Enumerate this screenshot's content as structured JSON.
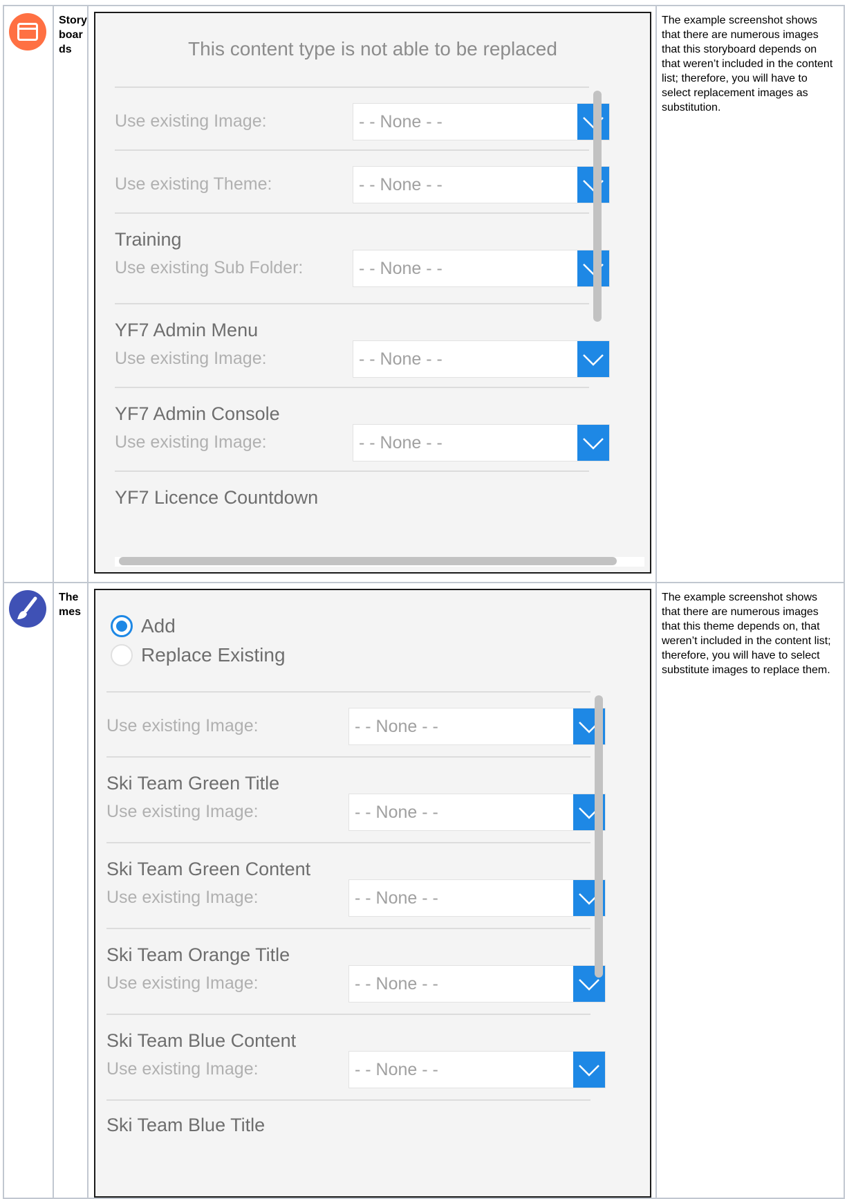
{
  "rows": [
    {
      "name": "Storyboards",
      "description": "The example screenshot shows that there are numerous images that this storyboard depends on that weren’t included in the content list; therefore, you will have to select replacement images as substitution.",
      "colors": {
        "icon": "#ff7043"
      },
      "panel": {
        "title": "This content type is not able to be replaced",
        "items": [
          {
            "title": "",
            "label": "Use existing Image:",
            "value": "- - None - -"
          },
          {
            "title": "",
            "label": "Use existing Theme:",
            "value": "- - None - -"
          },
          {
            "title": "Training",
            "label": "Use existing Sub Folder:",
            "value": "- - None - -"
          },
          {
            "title": "YF7 Admin Menu",
            "label": "Use existing Image:",
            "value": "- - None - -"
          },
          {
            "title": "YF7 Admin Console",
            "label": "Use existing Image:",
            "value": "- - None - -"
          },
          {
            "title": "YF7 Licence Countdown",
            "label": "",
            "value": ""
          }
        ]
      }
    },
    {
      "name": "Themes",
      "description": "The example screenshot shows that there are numerous images that this theme depends on, that weren’t included in the content list; therefore, you will have to select substitute images to replace them.",
      "colors": {
        "icon": "#3f51b5"
      },
      "panel": {
        "radio": [
          {
            "label": "Add",
            "selected": true
          },
          {
            "label": "Replace Existing",
            "selected": false
          }
        ],
        "items": [
          {
            "title": "",
            "label": "Use existing Image:",
            "value": "- - None - -"
          },
          {
            "title": "Ski Team Green Title",
            "label": "Use existing Image:",
            "value": "- - None - -"
          },
          {
            "title": "Ski Team Green Content",
            "label": "Use existing Image:",
            "value": "- - None - -"
          },
          {
            "title": "Ski Team Orange Title",
            "label": "Use existing Image:",
            "value": "- - None - -"
          },
          {
            "title": "Ski Team Blue Content",
            "label": "Use existing Image:",
            "value": "- - None - -"
          },
          {
            "title": "Ski Team Blue Title",
            "label": "",
            "value": ""
          }
        ]
      }
    }
  ],
  "colors": {
    "accent": "#1e88e5",
    "border": "#c1c7d0",
    "panel_bg": "#f4f4f4"
  }
}
